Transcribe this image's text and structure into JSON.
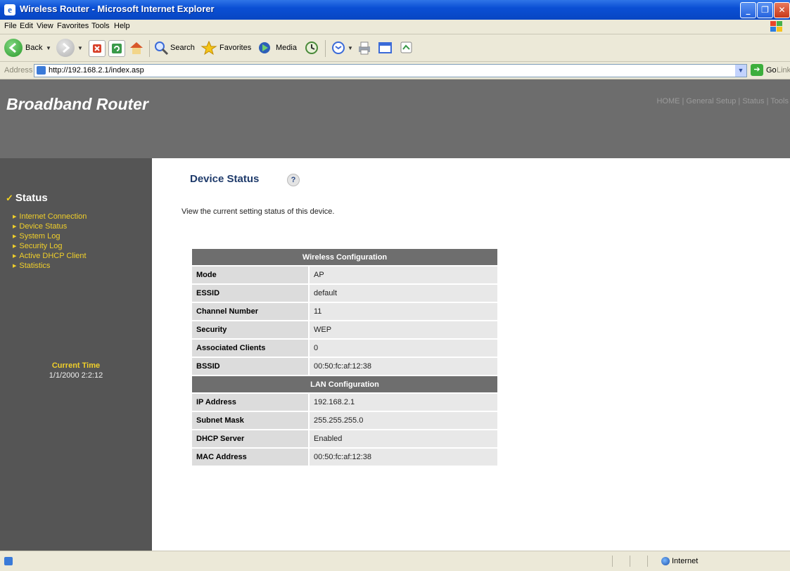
{
  "window": {
    "title": "Wireless Router - Microsoft Internet Explorer",
    "buttons": [
      "minimize-button",
      "maximize-button",
      "close-button"
    ]
  },
  "menu": {
    "file": "File",
    "edit": "Edit",
    "view": "View",
    "favorites": "Favorites",
    "tools": "Tools",
    "help": "Help"
  },
  "toolbar": {
    "back": "Back",
    "search": "Search",
    "favorites": "Favorites",
    "media": "Media"
  },
  "address": {
    "label": "Address",
    "url": "http://192.168.2.1/index.asp",
    "go": "Go",
    "links": "Links"
  },
  "router": {
    "brand": "Broadband Router",
    "nav": [
      "HOME",
      "General Setup",
      "Status",
      "Tools"
    ]
  },
  "sidebar": {
    "heading": "Status",
    "items": [
      {
        "label": "Internet Connection"
      },
      {
        "label": "Device Status"
      },
      {
        "label": "System Log"
      },
      {
        "label": "Security Log"
      },
      {
        "label": "Active DHCP Client"
      },
      {
        "label": "Statistics"
      }
    ],
    "current_time_label": "Current Time",
    "current_time_value": "1/1/2000 2:2:12"
  },
  "content": {
    "title": "Device Status",
    "description": "View the current setting status of this device.",
    "wireless_header": "Wireless Configuration",
    "wireless": [
      {
        "key": "Mode",
        "value": "AP"
      },
      {
        "key": "ESSID",
        "value": "default"
      },
      {
        "key": "Channel Number",
        "value": "11"
      },
      {
        "key": "Security",
        "value": "WEP"
      },
      {
        "key": "Associated Clients",
        "value": "0"
      },
      {
        "key": "BSSID",
        "value": "00:50:fc:af:12:38"
      }
    ],
    "lan_header": "LAN Configuration",
    "lan": [
      {
        "key": "IP Address",
        "value": "192.168.2.1"
      },
      {
        "key": "Subnet Mask",
        "value": "255.255.255.0"
      },
      {
        "key": "DHCP Server",
        "value": "Enabled"
      },
      {
        "key": "MAC Address",
        "value": "00:50:fc:af:12:38"
      }
    ]
  },
  "status_bar": {
    "zone": "Internet"
  },
  "colors": {
    "banner": "#6d6d6d",
    "sidebar": "#555555",
    "sidebar_link": "#f0cf2a",
    "title_blue": "#1f3b6b"
  }
}
